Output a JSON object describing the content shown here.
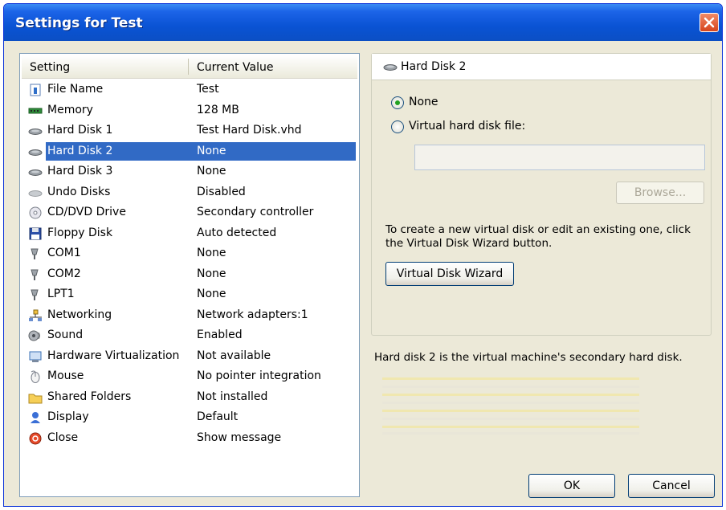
{
  "window": {
    "title": "Settings for Test"
  },
  "list": {
    "headers": {
      "setting": "Setting",
      "value": "Current Value"
    },
    "rows": [
      {
        "name": "File Name",
        "value": "Test",
        "icon": "file-name-icon"
      },
      {
        "name": "Memory",
        "value": "128 MB",
        "icon": "memory-icon"
      },
      {
        "name": "Hard Disk 1",
        "value": "Test Hard Disk.vhd",
        "icon": "hard-disk-icon"
      },
      {
        "name": "Hard Disk 2",
        "value": "None",
        "icon": "hard-disk-icon",
        "selected": true
      },
      {
        "name": "Hard Disk 3",
        "value": "None",
        "icon": "hard-disk-icon"
      },
      {
        "name": "Undo Disks",
        "value": "Disabled",
        "icon": "undo-disks-icon"
      },
      {
        "name": "CD/DVD Drive",
        "value": "Secondary controller",
        "icon": "cd-dvd-icon"
      },
      {
        "name": "Floppy Disk",
        "value": "Auto detected",
        "icon": "floppy-icon"
      },
      {
        "name": "COM1",
        "value": "None",
        "icon": "com-port-icon"
      },
      {
        "name": "COM2",
        "value": "None",
        "icon": "com-port-icon"
      },
      {
        "name": "LPT1",
        "value": "None",
        "icon": "lpt-port-icon"
      },
      {
        "name": "Networking",
        "value": "Network adapters:1",
        "icon": "networking-icon"
      },
      {
        "name": "Sound",
        "value": "Enabled",
        "icon": "sound-icon"
      },
      {
        "name": "Hardware Virtualization",
        "value": "Not available",
        "icon": "hardware-virtualization-icon"
      },
      {
        "name": "Mouse",
        "value": "No pointer integration",
        "icon": "mouse-icon"
      },
      {
        "name": "Shared Folders",
        "value": "Not installed",
        "icon": "folder-icon"
      },
      {
        "name": "Display",
        "value": "Default",
        "icon": "display-icon"
      },
      {
        "name": "Close",
        "value": "Show message",
        "icon": "close-setting-icon"
      }
    ]
  },
  "panel": {
    "title": "Hard Disk 2",
    "radio_none": "None",
    "radio_vhd": "Virtual hard disk file:",
    "selected_option": "None",
    "path_value": "",
    "browse_label": "Browse...",
    "info": "To create a new virtual disk or edit an existing one, click the Virtual Disk Wizard button.",
    "wizard_label": "Virtual Disk Wizard"
  },
  "description": "Hard disk 2 is the virtual machine's secondary hard disk.",
  "footer": {
    "ok_label": "OK",
    "cancel_label": "Cancel"
  },
  "colors": {
    "selection": "#316ac5",
    "titlebar": "#0a53d4",
    "dialog_bg": "#ece9d8"
  }
}
